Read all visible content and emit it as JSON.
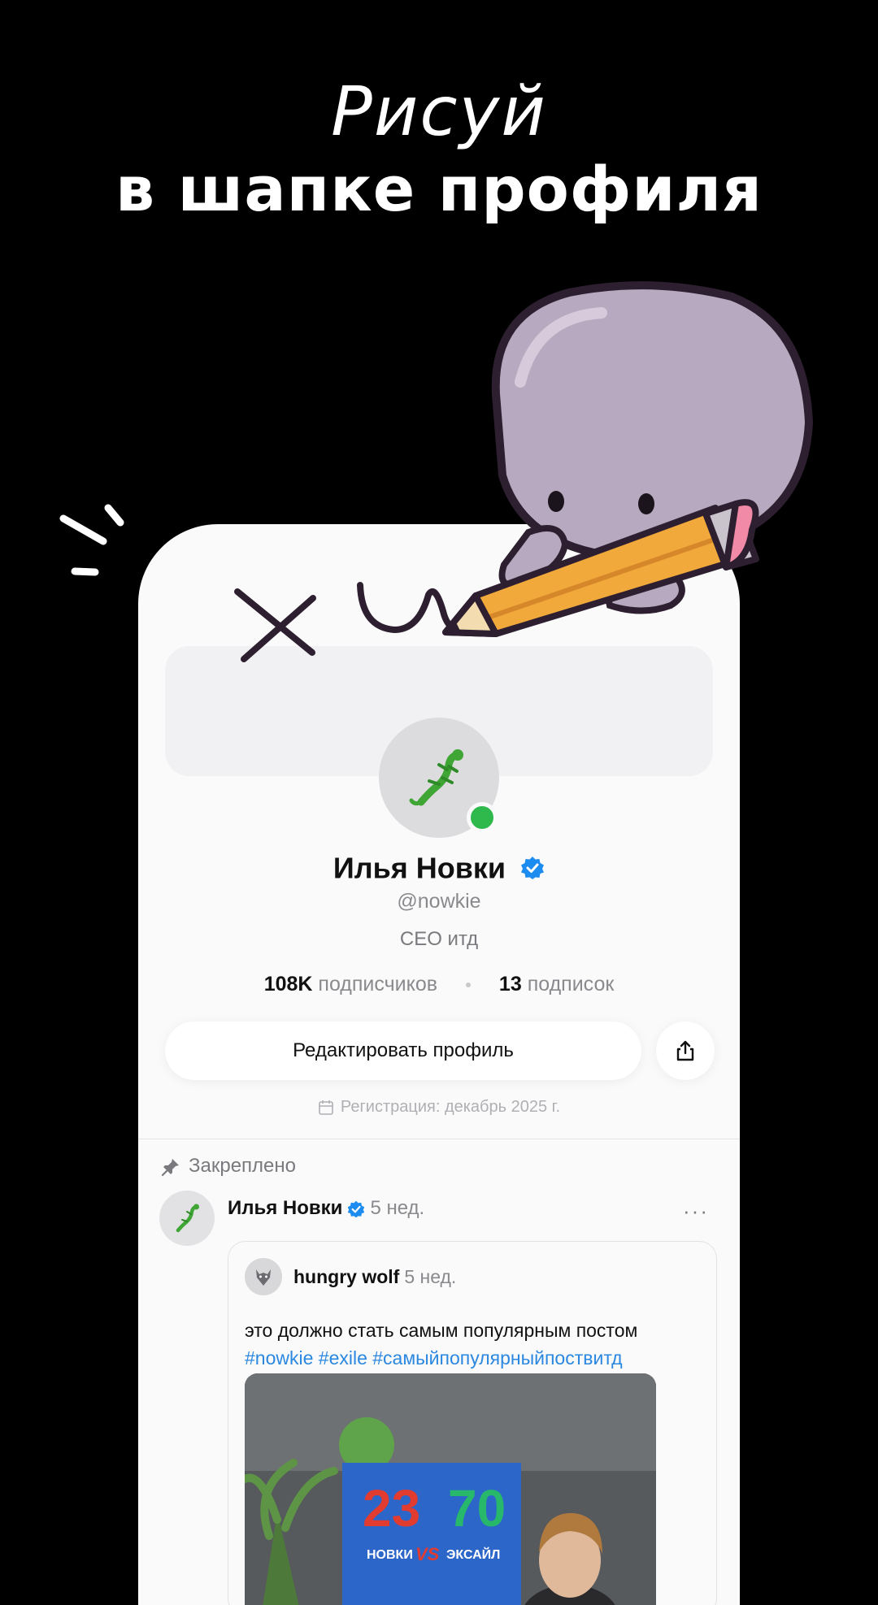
{
  "headline": {
    "script_line": "Рисуй",
    "main_line": "в шапке профиля"
  },
  "profile": {
    "name": "Илья Новки",
    "handle": "@nowkie",
    "bio": "CEO итд",
    "followers_count": "108K",
    "followers_label": "подписчиков",
    "following_count": "13",
    "following_label": "подписок",
    "edit_button": "Редактировать профиль",
    "registration": "Регистрация: декабрь 2025 г.",
    "online_color": "#2fb84c",
    "verified_color": "#1d8cf0"
  },
  "post": {
    "pinned_label": "Закреплено",
    "author": "Илья Новки",
    "time": "5 нед.",
    "more": "···",
    "quote": {
      "author": "hungry wolf",
      "time": "5 нед.",
      "text": "это должно стать самым популярным постом",
      "tags": "#nowkie #exile #самыйпопулярныйпоствитд",
      "media": {
        "score_left": "23",
        "score_right": "70",
        "caption_left": "НОВКИ",
        "caption_vs": "VS",
        "caption_right": "ЭКСАЙЛ"
      }
    }
  }
}
